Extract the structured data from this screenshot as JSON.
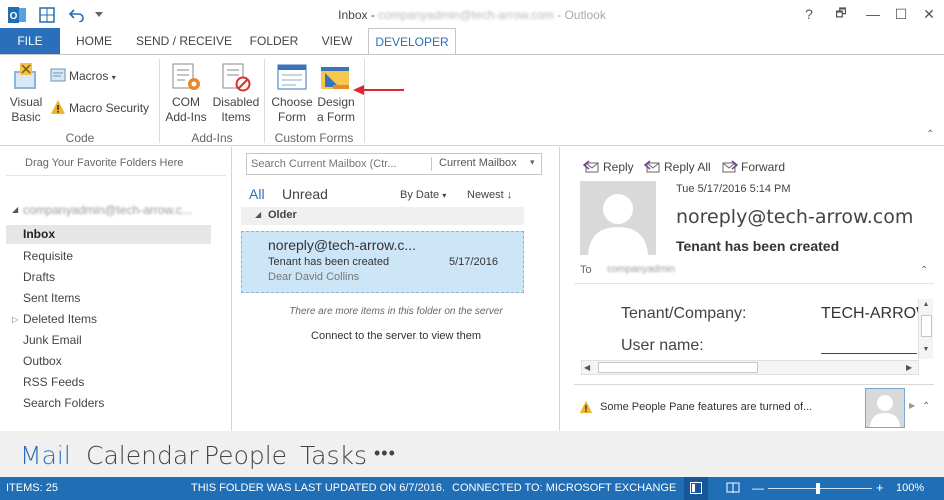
{
  "titlebar": {
    "prefix": "Inbox - ",
    "account": "companyadmin@tech-arrow.com",
    "suffix": " - Outlook"
  },
  "window_controls": {
    "help": "?",
    "restore": "🗗",
    "minimize": "—",
    "maximize": "☐",
    "close": "✕"
  },
  "tabs": [
    "FILE",
    "HOME",
    "SEND / RECEIVE",
    "FOLDER",
    "VIEW",
    "DEVELOPER"
  ],
  "ribbon": {
    "code": {
      "visual_basic_1": "Visual",
      "visual_basic_2": "Basic",
      "macros": "Macros",
      "macro_security": "Macro Security",
      "label": "Code"
    },
    "addins": {
      "com_1": "COM",
      "com_2": "Add-Ins",
      "disabled_1": "Disabled",
      "disabled_2": "Items",
      "label": "Add-Ins"
    },
    "forms": {
      "choose_1": "Choose",
      "choose_2": "Form",
      "design_1": "Design",
      "design_2": "a Form",
      "label": "Custom Forms"
    }
  },
  "folders": {
    "drag_hint": "Drag Your Favorite Folders Here",
    "account": "companyadmin@tech-arrow.c...",
    "items": [
      "Inbox",
      "Requisite",
      "Drafts",
      "Sent Items",
      "Deleted Items",
      "Junk Email",
      "Outbox",
      "RSS Feeds",
      "Search Folders"
    ]
  },
  "messages": {
    "search_placeholder": "Search Current Mailbox (Ctr...",
    "scope": "Current Mailbox",
    "filter_all": "All",
    "filter_unread": "Unread",
    "sort_by": "By Date",
    "order": "Newest",
    "group": "Older",
    "item": {
      "from": "noreply@tech-arrow.c...",
      "subject": "Tenant has been created",
      "date": "5/17/2016",
      "preview": "Dear David Collins"
    },
    "more_note": "There are more items in this folder on the server",
    "connect": "Connect to the server to view them"
  },
  "reading": {
    "reply": "Reply",
    "reply_all": "Reply All",
    "forward": "Forward",
    "date": "Tue 5/17/2016 5:14 PM",
    "from": "noreply@tech-arrow.com",
    "subject": "Tenant has been created",
    "to_label": "To",
    "to_value": "companyadmin",
    "body_label1": "Tenant/Company:",
    "body_value1": "TECH-ARROW",
    "body_label2": "User name:",
    "people_warning": "Some People Pane features are turned of..."
  },
  "nav": [
    "Mail",
    "Calendar",
    "People",
    "Tasks",
    "•••"
  ],
  "status": {
    "items": "ITEMS: 25",
    "updated": "THIS FOLDER WAS LAST UPDATED ON 6/7/2016.",
    "connected": "CONNECTED TO: MICROSOFT EXCHANGE",
    "zoom": "100%"
  },
  "colors": {
    "accent": "#2a6fba",
    "status": "#1f6eb6",
    "selected_msg": "#cde6f7",
    "arrow": "#e0262e"
  }
}
